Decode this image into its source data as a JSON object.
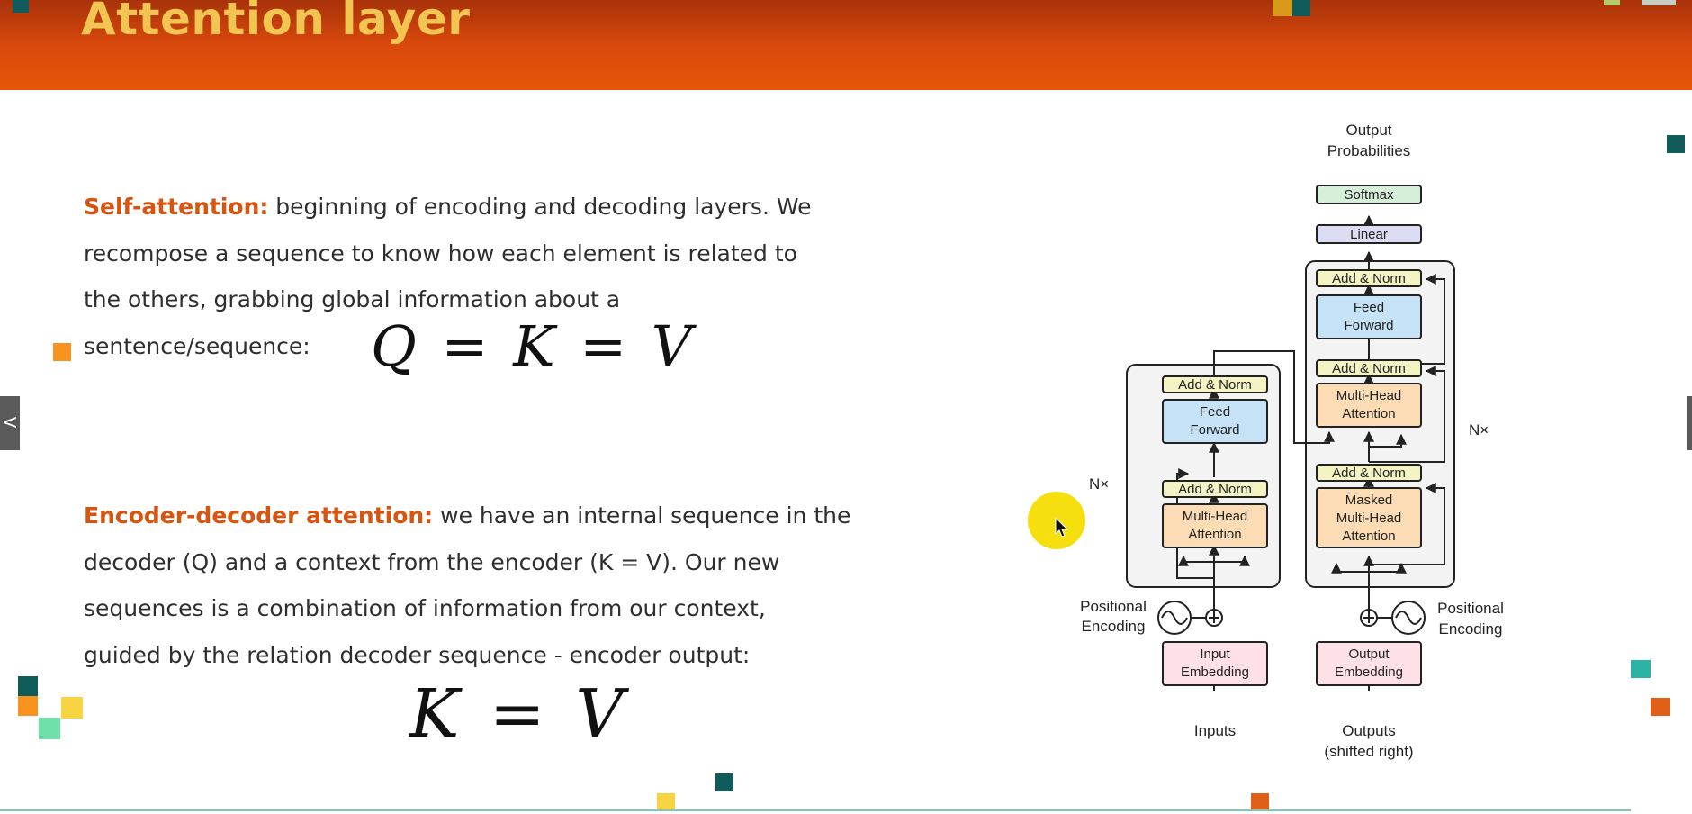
{
  "header": {
    "title": "Attention layer"
  },
  "self_attention": {
    "term": "Self-attention:",
    "line1": " beginning of encoding and decoding layers. We",
    "line2": "recompose a sequence to know how each element is related to",
    "line3": "the others, grabbing global information about a",
    "line4": "sentence/sequence:",
    "equation": "Q = K = V"
  },
  "encoder_decoder_attention": {
    "term": "Encoder-decoder attention:",
    "line1": " we have an internal sequence in the",
    "line2": "decoder (Q) and a context from the encoder (K = V). Our new",
    "line3": "sequences is a combination of information from our context,",
    "line4": "guided by the relation decoder sequence - encoder output:",
    "equation": "K = V"
  },
  "diagram": {
    "output_probabilities": [
      "Output",
      "Probabilities"
    ],
    "softmax": "Softmax",
    "linear": "Linear",
    "add_norm": "Add & Norm",
    "feed_forward": [
      "Feed",
      "Forward"
    ],
    "multi_head_attention": [
      "Multi-Head",
      "Attention"
    ],
    "masked_multi_head_attention": [
      "Masked",
      "Multi-Head",
      "Attention"
    ],
    "nx": "N×",
    "positional_encoding": [
      "Positional",
      "Encoding"
    ],
    "input_embedding": [
      "Input",
      "Embedding"
    ],
    "output_embedding": [
      "Output",
      "Embedding"
    ],
    "inputs": "Inputs",
    "outputs": [
      "Outputs",
      "(shifted right)"
    ]
  },
  "navigation": {
    "prev_icon": "chevron-left-icon",
    "prev_glyph": "<"
  },
  "colors": {
    "header_orange": "#e85508",
    "title_gold": "#f2c452",
    "highlight_orange": "#d9540e",
    "teal": "#0f5c5a",
    "aqua": "#2bb3a5",
    "yellow": "#f7d542",
    "mint": "#6fe0a8",
    "cursor_yellow": "#f6df0e",
    "softmax_green": "#d6efd8",
    "linear_lavender": "#dcdcf2",
    "addnorm_yellow": "#f4f3c4",
    "feedforward_blue": "#c6e2f7",
    "attention_orange": "#fcdcb4",
    "embedding_pink": "#fde1e6"
  }
}
